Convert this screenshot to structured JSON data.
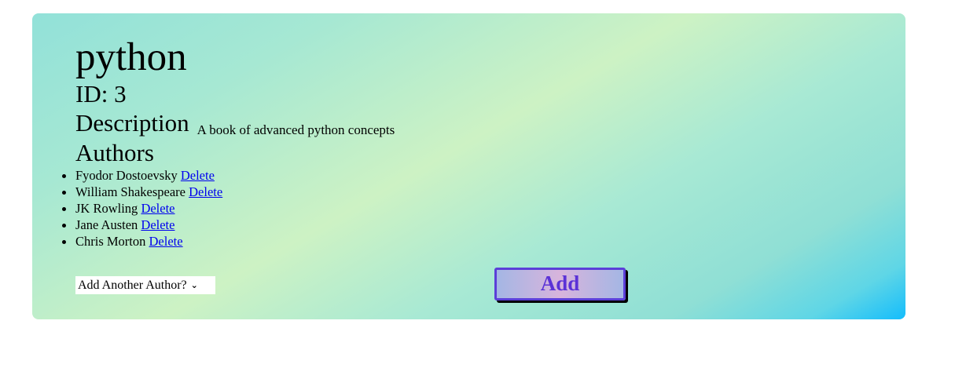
{
  "book": {
    "title": "python",
    "id_label": "ID: 3",
    "description_heading": "Description",
    "description_text": "A book of advanced python concepts",
    "authors_heading": "Authors"
  },
  "authors": [
    {
      "name": "Fyodor Dostoevsky",
      "delete_label": "Delete"
    },
    {
      "name": "William Shakespeare",
      "delete_label": "Delete"
    },
    {
      "name": "JK Rowling",
      "delete_label": "Delete"
    },
    {
      "name": "Jane Austen",
      "delete_label": "Delete"
    },
    {
      "name": "Chris Morton",
      "delete_label": "Delete"
    }
  ],
  "add_author": {
    "select_value": "Add Another Author?",
    "button_label": "Add"
  },
  "colors": {
    "link": "#0000ee",
    "button_border": "#5b3fd8",
    "button_text": "#5b32d6",
    "gradient_start": "#92e1d9",
    "gradient_mid": "#cdf2c4",
    "gradient_end": "#14bdfc"
  }
}
